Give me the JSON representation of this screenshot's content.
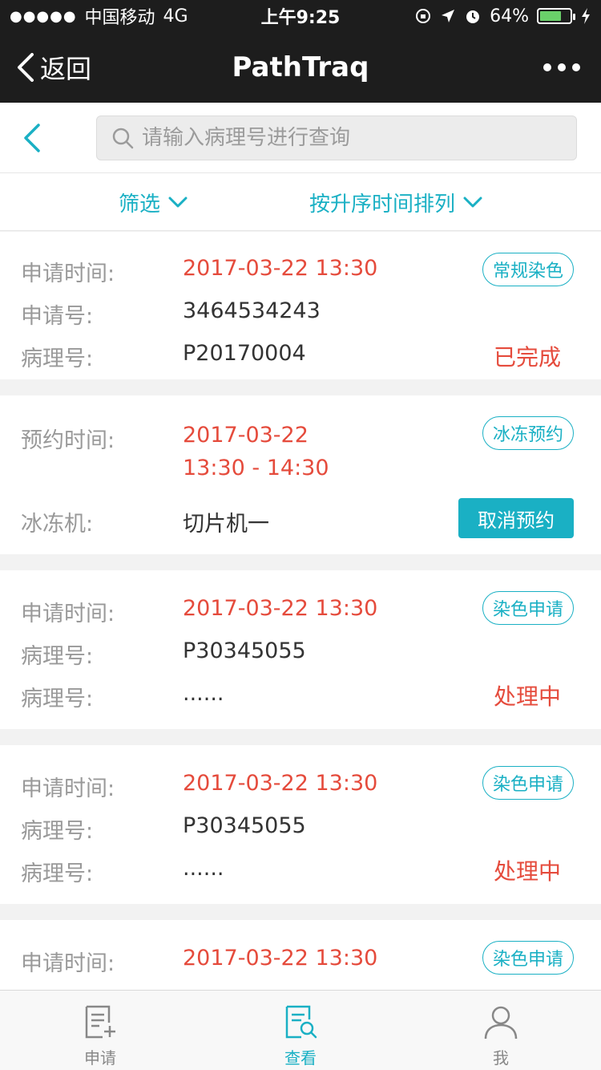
{
  "status_bar": {
    "signal_dots": "●●●●●",
    "carrier": "中国移动",
    "network": "4G",
    "time": "上午9:25",
    "battery": "64%"
  },
  "nav": {
    "back_label": "返回",
    "title": "PathTraq"
  },
  "search": {
    "placeholder": "请输入病理号进行查询"
  },
  "filters": {
    "filter_label": "筛选",
    "sort_label": "按升序时间排列"
  },
  "cards": [
    {
      "tag": "常规染色",
      "rows": [
        {
          "label": "申请时间:",
          "value": "2017-03-22   13:30"
        },
        {
          "label": "申请号:",
          "value": "3464534243"
        },
        {
          "label": "病理号:",
          "value": "P20170004"
        }
      ],
      "status": "已完成"
    },
    {
      "tag": "冰冻预约",
      "rows": [
        {
          "label": "预约时间:",
          "value": "2017-03-22",
          "value2": "13:30 - 14:30"
        },
        {
          "label": "冰冻机:",
          "value": "切片机一"
        }
      ],
      "button": "取消预约"
    },
    {
      "tag": "染色申请",
      "rows": [
        {
          "label": "申请时间:",
          "value": "2017-03-22   13:30"
        },
        {
          "label": "病理号:",
          "value": "P30345055"
        },
        {
          "label": "病理号:",
          "value": "......"
        }
      ],
      "status": "处理中"
    },
    {
      "tag": "染色申请",
      "rows": [
        {
          "label": "申请时间:",
          "value": "2017-03-22   13:30"
        },
        {
          "label": "病理号:",
          "value": "P30345055"
        },
        {
          "label": "病理号:",
          "value": "......"
        }
      ],
      "status": "处理中"
    },
    {
      "tag": "染色申请",
      "rows": [
        {
          "label": "申请时间:",
          "value": "2017-03-22   13:30"
        }
      ]
    }
  ],
  "tabs": [
    {
      "label": "申请",
      "icon": "document-add-icon"
    },
    {
      "label": "查看",
      "icon": "document-search-icon"
    },
    {
      "label": "我",
      "icon": "user-icon"
    }
  ],
  "colors": {
    "accent": "#1ab0c4",
    "red": "#e54b3c",
    "header_bg": "#1d1d1d"
  }
}
